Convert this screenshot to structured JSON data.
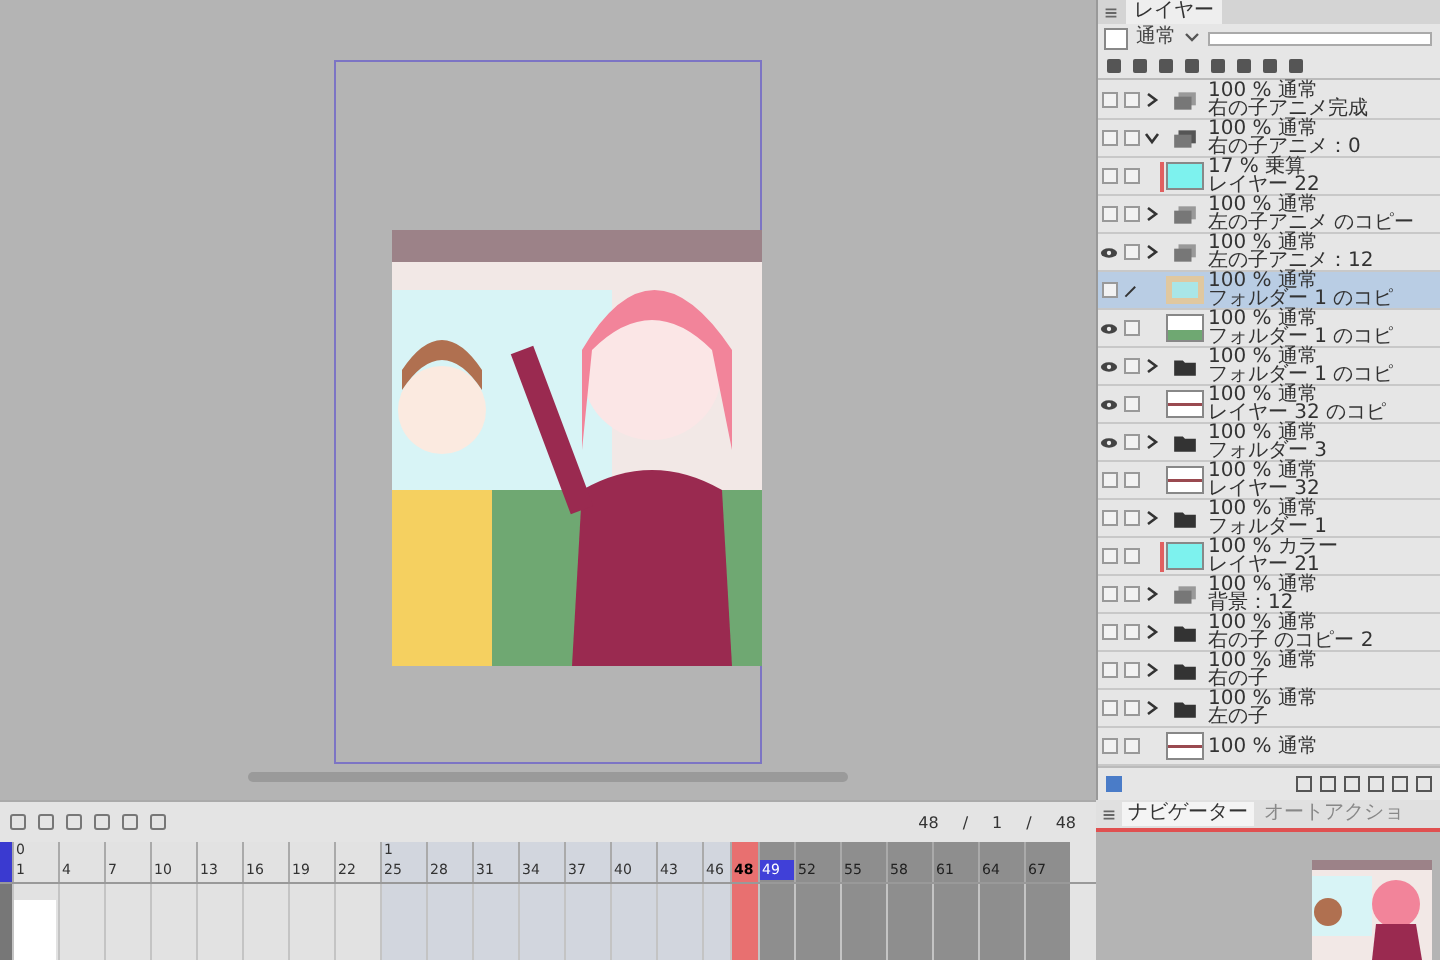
{
  "layer_panel": {
    "tab": "レイヤー",
    "blend_mode": "通常",
    "opacity": {
      "level": 1
    },
    "layers": [
      {
        "info": "100 % 通常",
        "name": "右の子アニメ完成",
        "kind": "anim_folder",
        "visible": false,
        "expanded": false,
        "selected": false,
        "editing": false,
        "marker": false
      },
      {
        "info": "100 % 通常",
        "name": "右の子アニメ：0",
        "kind": "anim_folder",
        "visible": false,
        "expanded": true,
        "selected": false,
        "editing": false,
        "marker": false
      },
      {
        "info": "17 % 乗算",
        "name": "レイヤー 22",
        "kind": "fill",
        "visible": false,
        "selected": false,
        "editing": false,
        "marker": true
      },
      {
        "info": "100 % 通常",
        "name": "左の子アニメ のコピー",
        "kind": "anim_folder",
        "visible": false,
        "expanded": false,
        "selected": false,
        "editing": false,
        "marker": false
      },
      {
        "info": "100 % 通常",
        "name": "左の子アニメ：12",
        "kind": "anim_folder",
        "visible": true,
        "expanded": false,
        "selected": false,
        "editing": false,
        "marker": false
      },
      {
        "info": "100 % 通常",
        "name": "フォルダー 1 のコピ",
        "kind": "frame",
        "visible": false,
        "selected": true,
        "editing": true,
        "marker": false
      },
      {
        "info": "100 % 通常",
        "name": "フォルダー 1 のコピ",
        "kind": "grass",
        "visible": true,
        "selected": false,
        "editing": false,
        "marker": false
      },
      {
        "info": "100 % 通常",
        "name": "フォルダー 1 のコピ",
        "kind": "folder",
        "visible": true,
        "expanded": false,
        "selected": false,
        "editing": false,
        "marker": false
      },
      {
        "info": "100 % 通常",
        "name": "レイヤー 32 のコピ",
        "kind": "stroke",
        "visible": true,
        "selected": false,
        "editing": false,
        "marker": false
      },
      {
        "info": "100 % 通常",
        "name": "フォルダー 3",
        "kind": "folder",
        "visible": true,
        "expanded": false,
        "selected": false,
        "editing": false,
        "marker": false
      },
      {
        "info": "100 % 通常",
        "name": "レイヤー 32",
        "kind": "stroke",
        "visible": false,
        "selected": false,
        "editing": false,
        "marker": false
      },
      {
        "info": "100 % 通常",
        "name": "フォルダー 1",
        "kind": "folder",
        "visible": false,
        "expanded": false,
        "selected": false,
        "editing": false,
        "marker": false
      },
      {
        "info": "100 % カラー",
        "name": "レイヤー 21",
        "kind": "fill",
        "visible": false,
        "selected": false,
        "editing": false,
        "marker": true
      },
      {
        "info": "100 % 通常",
        "name": "背景：12",
        "kind": "anim_folder",
        "visible": false,
        "expanded": false,
        "selected": false,
        "editing": false,
        "marker": false
      },
      {
        "info": "100 % 通常",
        "name": "右の子 のコピー 2",
        "kind": "folder",
        "visible": false,
        "expanded": false,
        "selected": false,
        "editing": false,
        "marker": false
      },
      {
        "info": "100 % 通常",
        "name": "右の子",
        "kind": "folder",
        "visible": false,
        "expanded": false,
        "selected": false,
        "editing": false,
        "marker": false
      },
      {
        "info": "100 % 通常",
        "name": "左の子",
        "kind": "folder",
        "visible": false,
        "expanded": false,
        "selected": false,
        "editing": false,
        "marker": false
      },
      {
        "info": "100 % 通常",
        "kind": "stroke",
        "visible": false,
        "selected": false,
        "editing": false,
        "marker": false
      }
    ]
  },
  "timeline": {
    "counter": [
      "48",
      "/",
      "1",
      "/",
      "48"
    ],
    "ruler": [
      {
        "text": "1",
        "kind": "tick",
        "cue": "0"
      },
      {
        "text": "4",
        "kind": "tick"
      },
      {
        "text": "7",
        "kind": "tick"
      },
      {
        "text": "10",
        "kind": "tick"
      },
      {
        "text": "13",
        "kind": "tick"
      },
      {
        "text": "16",
        "kind": "tick"
      },
      {
        "text": "19",
        "kind": "tick"
      },
      {
        "text": "22",
        "kind": "tick"
      },
      {
        "text": "25",
        "kind": "tick_alt",
        "cue": "1"
      },
      {
        "text": "28",
        "kind": "tick_alt"
      },
      {
        "text": "31",
        "kind": "tick_alt"
      },
      {
        "text": "34",
        "kind": "tick_alt"
      },
      {
        "text": "37",
        "kind": "tick_alt"
      },
      {
        "text": "40",
        "kind": "tick_alt"
      },
      {
        "text": "43",
        "kind": "tick_alt"
      },
      {
        "text": "46",
        "kind": "tick_alt"
      },
      {
        "text": "48",
        "kind": "playhead"
      },
      {
        "text": "49",
        "kind": "end"
      },
      {
        "text": "52",
        "kind": "tick_out"
      },
      {
        "text": "55",
        "kind": "tick_out"
      },
      {
        "text": "58",
        "kind": "tick_out"
      },
      {
        "text": "61",
        "kind": "tick_out"
      },
      {
        "text": "64",
        "kind": "tick_out"
      },
      {
        "text": "67",
        "kind": "tick_out"
      }
    ]
  },
  "navigator": {
    "tabs": [
      {
        "label": "ナビゲーター",
        "selected": true
      },
      {
        "label": "オートアクショ",
        "selected": false
      }
    ]
  }
}
